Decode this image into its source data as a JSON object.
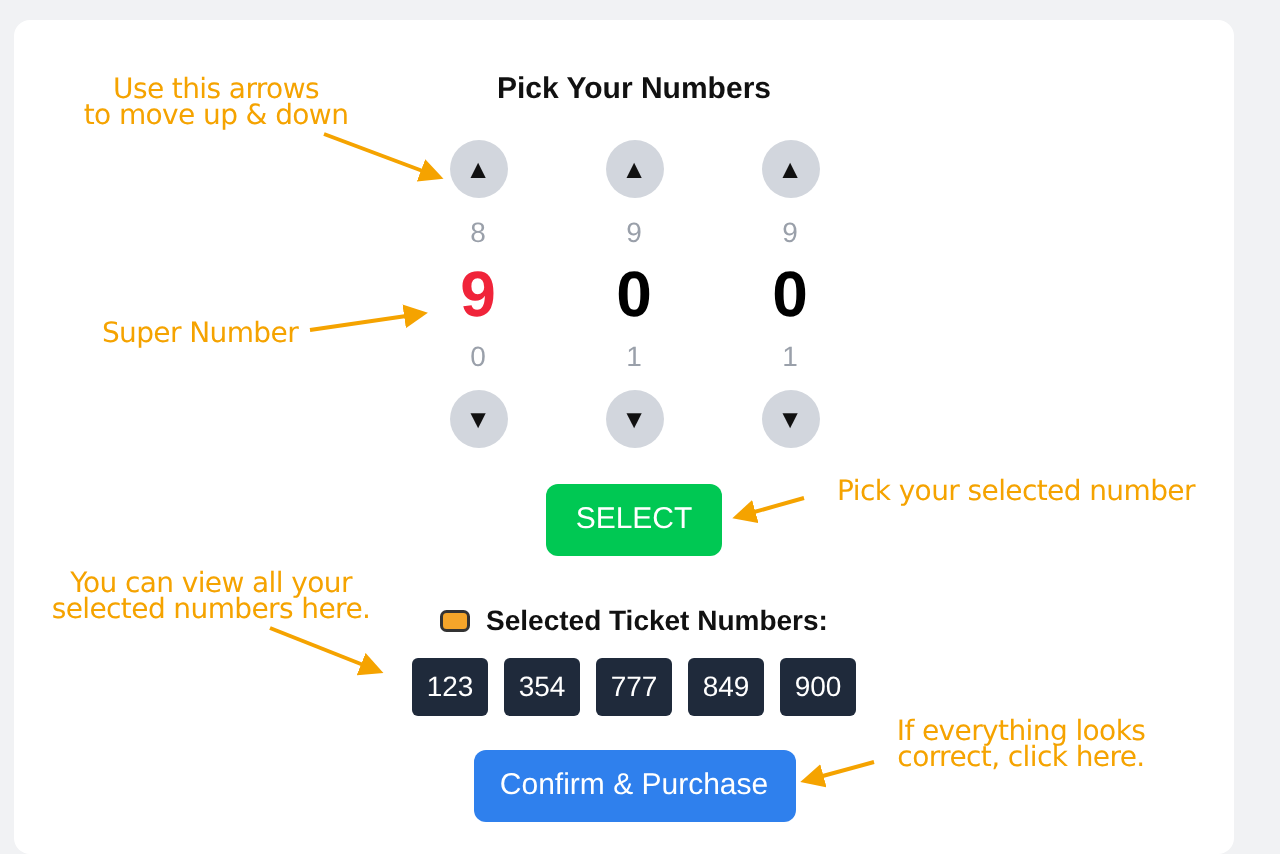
{
  "title": "Pick Your Numbers",
  "digits": [
    {
      "up": "▲",
      "previous": "8",
      "current": "9",
      "next": "0",
      "down": "▼",
      "super": true
    },
    {
      "up": "▲",
      "previous": "9",
      "current": "0",
      "next": "1",
      "down": "▼",
      "super": false
    },
    {
      "up": "▲",
      "previous": "9",
      "current": "0",
      "next": "1",
      "down": "▼",
      "super": false
    }
  ],
  "select_button": "SELECT",
  "selected_label": "Selected Ticket Numbers:",
  "tickets": [
    "123",
    "354",
    "777",
    "849",
    "900"
  ],
  "confirm_button": "Confirm & Purchase",
  "annotations": [
    {
      "lines": [
        "Use this arrows",
        "to move up & down"
      ]
    },
    {
      "lines": [
        "Super Number"
      ]
    },
    {
      "lines": [
        "Pick your selected number"
      ]
    },
    {
      "lines": [
        "You can view all your",
        "selected numbers here."
      ]
    },
    {
      "lines": [
        "If everything looks",
        "correct, click here."
      ]
    }
  ]
}
